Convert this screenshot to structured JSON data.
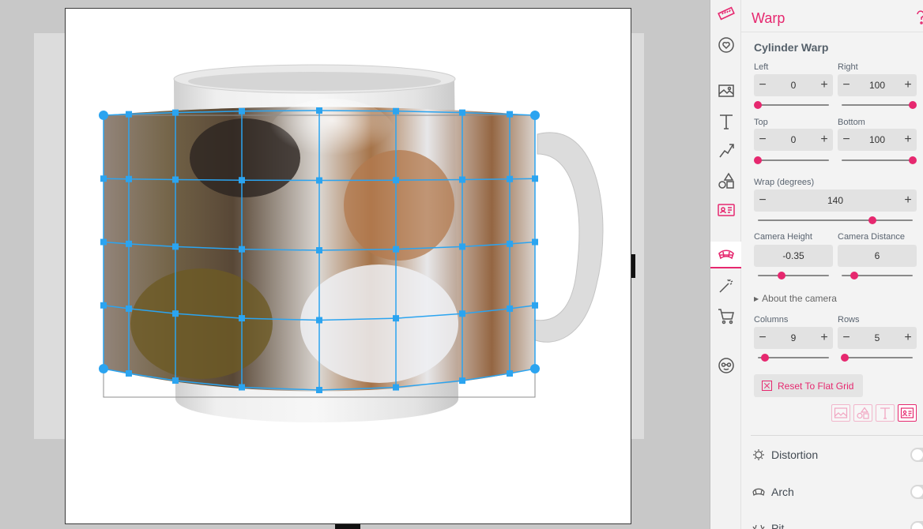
{
  "panel": {
    "title": "Warp",
    "section_title": "Cylinder Warp",
    "left": {
      "label": "Left",
      "value": "0",
      "slider": 0.0
    },
    "right": {
      "label": "Right",
      "value": "100",
      "slider": 1.0
    },
    "top": {
      "label": "Top",
      "value": "0",
      "slider": 0.0
    },
    "bottom": {
      "label": "Bottom",
      "value": "100",
      "slider": 1.0
    },
    "wrap": {
      "label": "Wrap (degrees)",
      "value": "140",
      "slider": 0.74
    },
    "camera_height": {
      "label": "Camera Height",
      "value": "-0.35",
      "slider": 0.33
    },
    "camera_distance": {
      "label": "Camera Distance",
      "value": "6",
      "slider": 0.18
    },
    "about_camera": "About the camera",
    "columns": {
      "label": "Columns",
      "value": "9",
      "slider": 0.1
    },
    "rows": {
      "label": "Rows",
      "value": "5",
      "slider": 0.04
    },
    "minus_glyph": "−",
    "plus_glyph": "+",
    "reset_label": "Reset To Flat Grid",
    "effects": [
      {
        "label": "Distortion",
        "icon": "distortion-icon",
        "enabled": false
      },
      {
        "label": "Arch",
        "icon": "arch-icon",
        "enabled": false
      },
      {
        "label": "Pit",
        "icon": "pit-icon",
        "enabled": false
      }
    ]
  },
  "tool_rail": [
    {
      "icon": "ruler-icon"
    },
    {
      "icon": "heart-badge-icon"
    },
    {
      "icon": "image-icon"
    },
    {
      "icon": "text-icon"
    },
    {
      "icon": "draw-icon"
    },
    {
      "icon": "shapes-icon"
    },
    {
      "icon": "id-card-icon"
    },
    {
      "icon": "warp-icon",
      "active": true
    },
    {
      "icon": "magic-wand-icon"
    },
    {
      "icon": "cart-icon"
    },
    {
      "icon": "face-glasses-icon"
    }
  ],
  "colors": {
    "accent": "#e6286f",
    "grid": "#2ba4f0",
    "panel_bg": "#f3f3f3"
  }
}
